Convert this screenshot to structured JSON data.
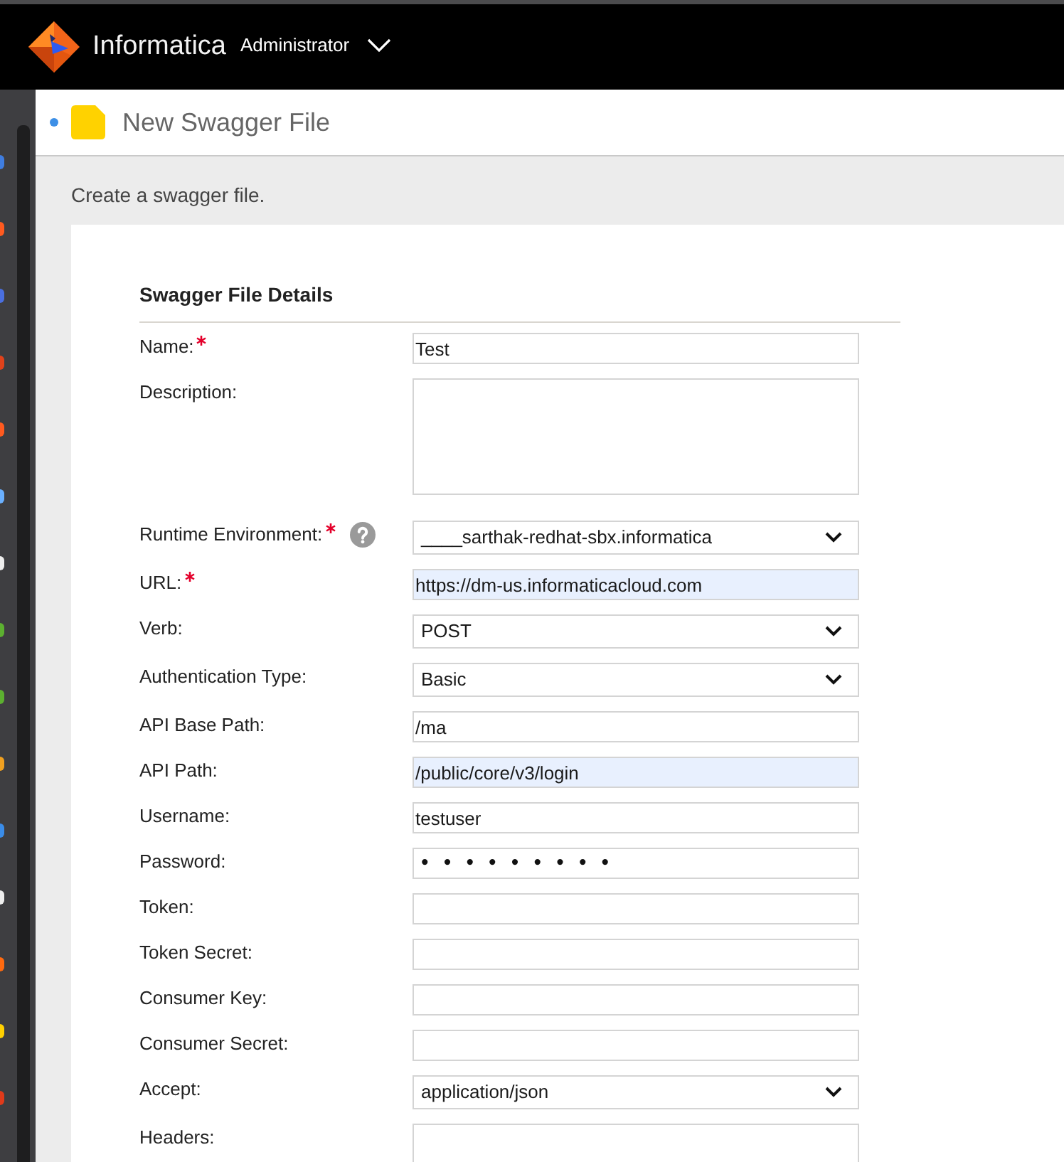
{
  "header": {
    "brand": "Informatica",
    "app": "Administrator"
  },
  "page": {
    "title": "New Swagger File",
    "subtitle": "Create a swagger file."
  },
  "form": {
    "section_title": "Swagger File Details",
    "fields": [
      {
        "label": "Name:",
        "kind": "text",
        "required": true,
        "help": false,
        "autofilled": false,
        "value": "Test"
      },
      {
        "label": "Description:",
        "kind": "textarea",
        "required": false,
        "help": false,
        "autofilled": false
      },
      {
        "label": "Runtime Environment:",
        "kind": "select",
        "required": true,
        "help": true,
        "autofilled": false,
        "value": "____sarthak-redhat-sbx.informatica"
      },
      {
        "label": "URL:",
        "kind": "text",
        "required": true,
        "help": false,
        "autofilled": true,
        "value": "https://dm-us.informaticacloud.com"
      },
      {
        "label": "Verb:",
        "kind": "select",
        "required": false,
        "help": false,
        "autofilled": false,
        "value": "POST"
      },
      {
        "label": "Authentication Type:",
        "kind": "select",
        "required": false,
        "help": false,
        "autofilled": false,
        "value": "Basic"
      },
      {
        "label": "API Base Path:",
        "kind": "text",
        "required": false,
        "help": false,
        "autofilled": false,
        "value": "/ma"
      },
      {
        "label": "API Path:",
        "kind": "text",
        "required": false,
        "help": false,
        "autofilled": true,
        "value": "/public/core/v3/login"
      },
      {
        "label": "Username:",
        "kind": "text",
        "required": false,
        "help": false,
        "autofilled": false,
        "value": "testuser"
      },
      {
        "label": "Password:",
        "kind": "password",
        "required": false,
        "help": false,
        "autofilled": false,
        "value": "•••••••••"
      },
      {
        "label": "Token:",
        "kind": "text",
        "required": false,
        "help": false,
        "autofilled": false
      },
      {
        "label": "Token Secret:",
        "kind": "text",
        "required": false,
        "help": false,
        "autofilled": false
      },
      {
        "label": "Consumer Key:",
        "kind": "text",
        "required": false,
        "help": false,
        "autofilled": false
      },
      {
        "label": "Consumer Secret:",
        "kind": "text",
        "required": false,
        "help": false,
        "autofilled": false
      },
      {
        "label": "Accept:",
        "kind": "select",
        "required": false,
        "help": false,
        "autofilled": false,
        "value": "application/json"
      },
      {
        "label": "Headers:",
        "kind": "textarea",
        "required": false,
        "help": false,
        "autofilled": false
      }
    ]
  }
}
